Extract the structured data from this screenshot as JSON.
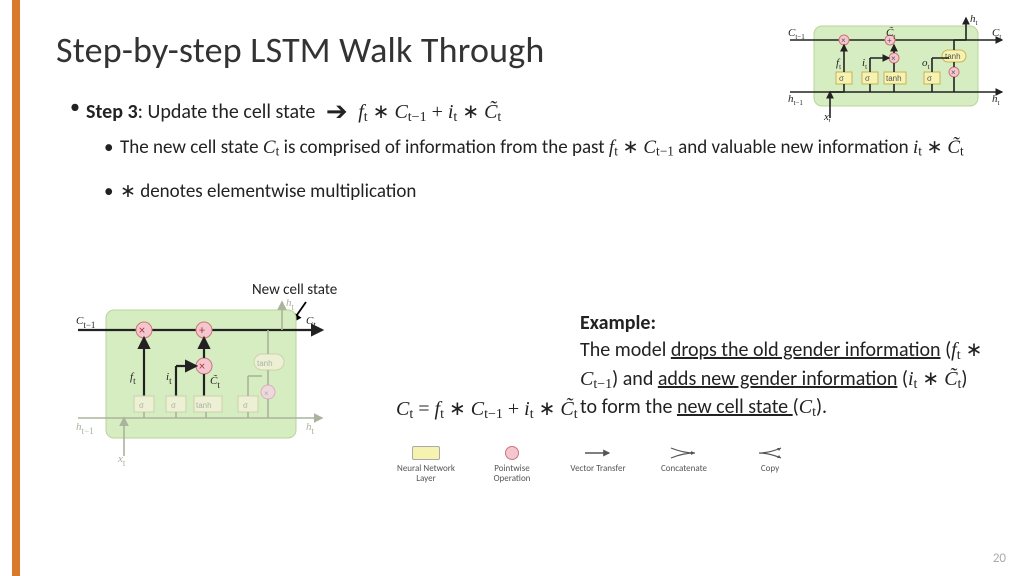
{
  "title": "Step-by-step LSTM Walk Through",
  "step": {
    "label_strong": "Step 3",
    "label_rest": ": Update the cell state",
    "formula_inline": "f_t * C_{t-1} + i_t * C̃_t"
  },
  "sub1_a": "The new cell state ",
  "sub1_var1": "C_t",
  "sub1_b": " is comprised of information from the past ",
  "sub1_var2": "f_t * C_{t-1}",
  "sub1_c": " and valuable new information ",
  "sub1_var3": "i_t * C̃_t",
  "sub2": "∗ denotes elementwise multiplication",
  "annot_new_cell_state": "New cell state",
  "mid_eq": "C_t = f_t * C_{t-1} + i_t * C̃_t",
  "legend": {
    "l1": "Neural Network Layer",
    "l2": "Pointwise Operation",
    "l3": "Vector Transfer",
    "l4": "Concatenate",
    "l5": "Copy"
  },
  "example": {
    "head": "Example:",
    "a": "The model ",
    "u1": "drops the old gender information",
    "p1": " (",
    "v1": "f_t * C_{t-1}",
    "p1b": ") and ",
    "u2": "adds new gender information",
    "p2": " (",
    "v2": "i_t * C̃_t",
    "p2b": ") to form the ",
    "u3": "new cell state ",
    "p3": "(",
    "v3": "C_t",
    "p3b": ")."
  },
  "diagram_labels": {
    "C_prev": "C_{t-1}",
    "C_t": "C_t",
    "h_prev": "h_{t-1}",
    "h_t": "h_t",
    "x_t": "x_t",
    "f_t": "f_t",
    "i_t": "i_t",
    "Ct_tilde": "C̃_t",
    "o_t": "o_t",
    "sigma": "σ",
    "tanh": "tanh"
  },
  "page_number": "20"
}
